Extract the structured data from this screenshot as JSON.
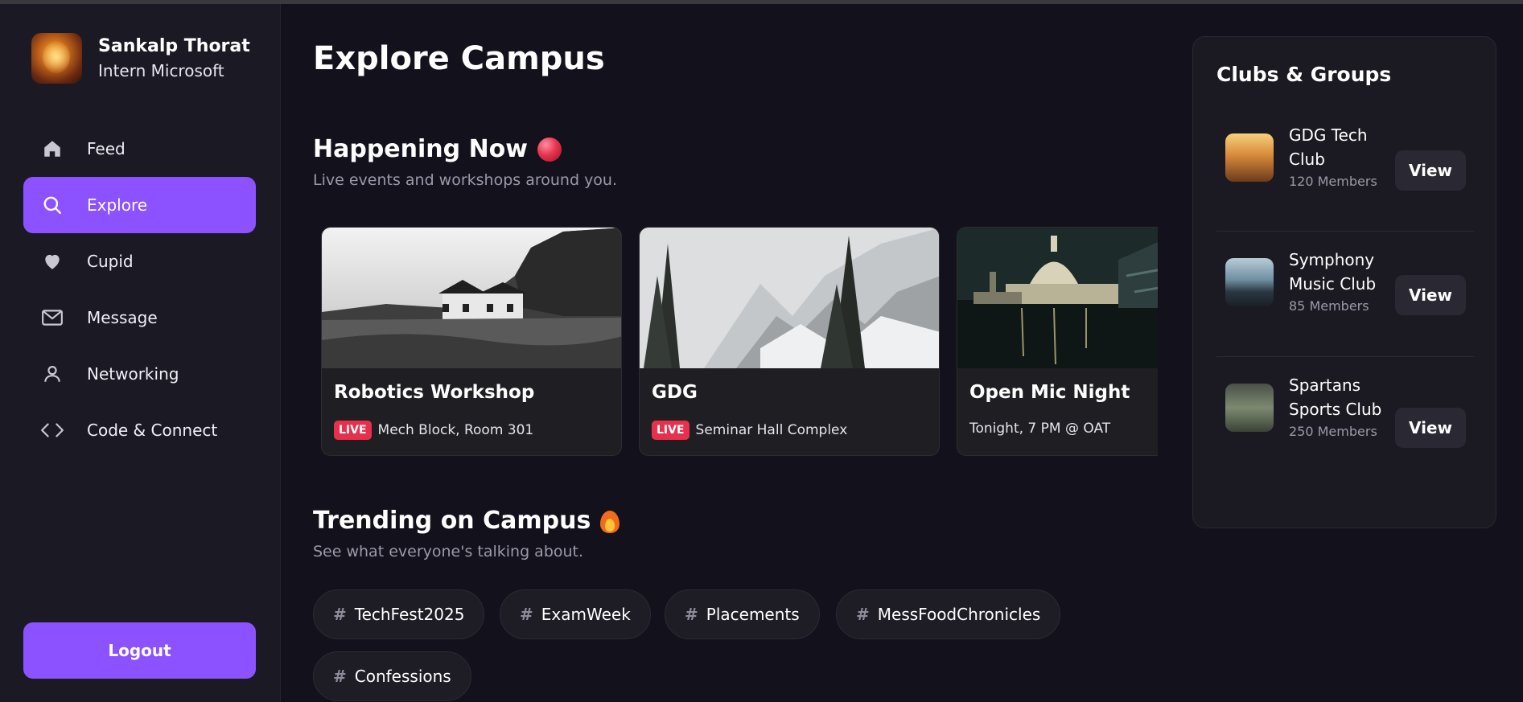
{
  "profile": {
    "name": "Sankalp Thorat",
    "role": "Intern Microsoft"
  },
  "nav": {
    "items": [
      {
        "label": "Feed",
        "icon": "home-icon",
        "active": false
      },
      {
        "label": "Explore",
        "icon": "search-icon",
        "active": true
      },
      {
        "label": "Cupid",
        "icon": "heart-icon",
        "active": false
      },
      {
        "label": "Message",
        "icon": "mail-icon",
        "active": false
      },
      {
        "label": "Networking",
        "icon": "user-icon",
        "active": false
      },
      {
        "label": "Code & Connect",
        "icon": "code-icon",
        "active": false
      }
    ],
    "logout_label": "Logout"
  },
  "main": {
    "title": "Explore Campus",
    "happening": {
      "title": "Happening Now",
      "subtitle": "Live events and workshops around you.",
      "events": [
        {
          "title": "Robotics Workshop",
          "live": true,
          "badge": "LIVE",
          "meta": "Mech Block, Room 301"
        },
        {
          "title": "GDG",
          "live": true,
          "badge": "LIVE",
          "meta": "Seminar Hall Complex"
        },
        {
          "title": "Open Mic Night",
          "live": false,
          "meta": "Tonight, 7 PM @ OAT"
        }
      ]
    },
    "trending": {
      "title": "Trending on Campus",
      "subtitle": "See what everyone's talking about.",
      "hash": "#",
      "tags": [
        "TechFest2025",
        "ExamWeek",
        "Placements",
        "MessFoodChronicles",
        "Confessions"
      ]
    }
  },
  "clubs": {
    "title": "Clubs & Groups",
    "view_label": "View",
    "items": [
      {
        "name": "GDG Tech Club",
        "members": "120 Members"
      },
      {
        "name": "Symphony Music Club",
        "members": "85 Members"
      },
      {
        "name": "Spartans Sports Club",
        "members": "250 Members"
      }
    ]
  },
  "colors": {
    "accent": "#8c52ff",
    "live": "#e8304c",
    "background": "#13111c"
  }
}
